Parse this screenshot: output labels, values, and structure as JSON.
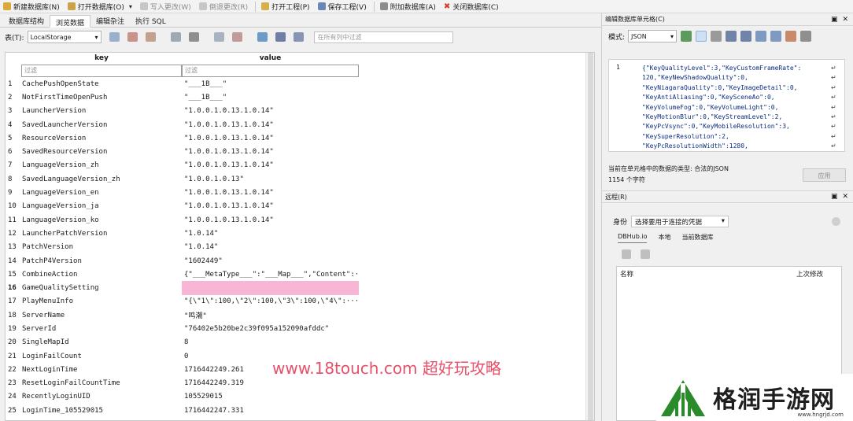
{
  "toolbar": {
    "buttons": [
      {
        "label": "新建数据库(N)"
      },
      {
        "label": "打开数据库(O)"
      },
      {
        "label": "写入更改(W)"
      },
      {
        "label": "倒退更改(R)"
      },
      {
        "label": "打开工程(P)"
      },
      {
        "label": "保存工程(V)"
      },
      {
        "label": "附加数据库(A)"
      },
      {
        "label": "关闭数据库(C)"
      }
    ]
  },
  "tabs": [
    {
      "label": "数据库结构"
    },
    {
      "label": "浏览数据"
    },
    {
      "label": "编辑杂注"
    },
    {
      "label": "执行 SQL"
    }
  ],
  "table_bar": {
    "label": "表(T):",
    "table_name": "LocalStorage",
    "filter_placeholder": "在所有列中过滤"
  },
  "grid": {
    "headers": {
      "key": "key",
      "value": "value"
    },
    "filter_key": "过滤",
    "filter_value": "过滤",
    "rows": [
      {
        "n": "1",
        "key": "CachePushOpenState",
        "value": "\"___1B___\""
      },
      {
        "n": "2",
        "key": "NotFirstTimeOpenPush",
        "value": "\"___1B___\""
      },
      {
        "n": "3",
        "key": "LauncherVersion",
        "value": "\"1.0.0.1.0.13.1.0.14\""
      },
      {
        "n": "4",
        "key": "SavedLauncherVersion",
        "value": "\"1.0.0.1.0.13.1.0.14\""
      },
      {
        "n": "5",
        "key": "ResourceVersion",
        "value": "\"1.0.0.1.0.13.1.0.14\""
      },
      {
        "n": "6",
        "key": "SavedResourceVersion",
        "value": "\"1.0.0.1.0.13.1.0.14\""
      },
      {
        "n": "7",
        "key": "LanguageVersion_zh",
        "value": "\"1.0.0.1.0.13.1.0.14\""
      },
      {
        "n": "8",
        "key": "SavedLanguageVersion_zh",
        "value": "\"1.0.0.1.0.13\""
      },
      {
        "n": "9",
        "key": "LanguageVersion_en",
        "value": "\"1.0.0.1.0.13.1.0.14\""
      },
      {
        "n": "10",
        "key": "LanguageVersion_ja",
        "value": "\"1.0.0.1.0.13.1.0.14\""
      },
      {
        "n": "11",
        "key": "LanguageVersion_ko",
        "value": "\"1.0.0.1.0.13.1.0.14\""
      },
      {
        "n": "12",
        "key": "LauncherPatchVersion",
        "value": "\"1.0.14\""
      },
      {
        "n": "13",
        "key": "PatchVersion",
        "value": "\"1.0.14\""
      },
      {
        "n": "14",
        "key": "PatchP4Version",
        "value": "\"1602449\""
      },
      {
        "n": "15",
        "key": "CombineAction",
        "value": "{\"___MetaType___\":\"___Map___\",\"Content\":···"
      },
      {
        "n": "16",
        "key": "GameQualitySetting",
        "value": "{\"KeyQualityLevel\":···",
        "selected": true
      },
      {
        "n": "17",
        "key": "PlayMenuInfo",
        "value": "\"{\\\"1\\\":100,\\\"2\\\":100,\\\"3\\\":100,\\\"4\\\":···"
      },
      {
        "n": "18",
        "key": "ServerName",
        "value": "\"鸣潮\""
      },
      {
        "n": "19",
        "key": "ServerId",
        "value": "\"76402e5b20be2c39f095a152090afddc\""
      },
      {
        "n": "20",
        "key": "SingleMapId",
        "value": "8"
      },
      {
        "n": "21",
        "key": "LoginFailCount",
        "value": "0"
      },
      {
        "n": "22",
        "key": "NextLoginTime",
        "value": "1716442249.261"
      },
      {
        "n": "23",
        "key": "ResetLoginFailCountTime",
        "value": "1716442249.319"
      },
      {
        "n": "24",
        "key": "RecentlyLoginUID",
        "value": "105529015"
      },
      {
        "n": "25",
        "key": "LoginTime_105529015",
        "value": "1716442247.331"
      }
    ]
  },
  "editor_panel": {
    "title": "编辑数据库单元格(C)",
    "mode_label": "模式:",
    "mode_value": "JSON",
    "line_number": "1",
    "code_lines": [
      "{\"KeyQualityLevel\":3,\"KeyCustomFrameRate\":",
      "120,\"KeyNewShadowQuality\":0,",
      "\"KeyNiagaraQuality\":0,\"KeyImageDetail\":0,",
      "\"KeyAntiAliasing\":0,\"KeySceneAo\":0,",
      "\"KeyVolumeFog\":0,\"KeyVolumeLight\":0,",
      "\"KeyMotionBlur\":0,\"KeyStreamLevel\":2,",
      "\"KeyPcVsync\":0,\"KeyMobileResolution\":3,",
      "\"KeySuperResolution\":2,",
      "\"KeyPcResolutionWidth\":1280,"
    ],
    "wrap_mark": "↵",
    "type_info": "当前在单元格中的数据的类型: 合法的JSON",
    "char_info": "1154 个字符",
    "apply_label": "应用"
  },
  "remote_panel": {
    "title": "远程(R)",
    "identity_label": "身份",
    "identity_value": "选择要用于连接的凭据",
    "subtabs": [
      {
        "label": "DBHub.io"
      },
      {
        "label": "本地"
      },
      {
        "label": "当前数据库"
      }
    ],
    "col_name": "名称",
    "col_modified": "上次修改"
  },
  "watermark": {
    "text": "www.18touch.com 超好玩攻略"
  },
  "logo": {
    "text": "格润手游网",
    "url": "www.hngrjd.com"
  },
  "colors": {
    "selected_cell": "#f7b6d4",
    "watermark": "#e8506a",
    "json_text": "#0b2d80"
  }
}
